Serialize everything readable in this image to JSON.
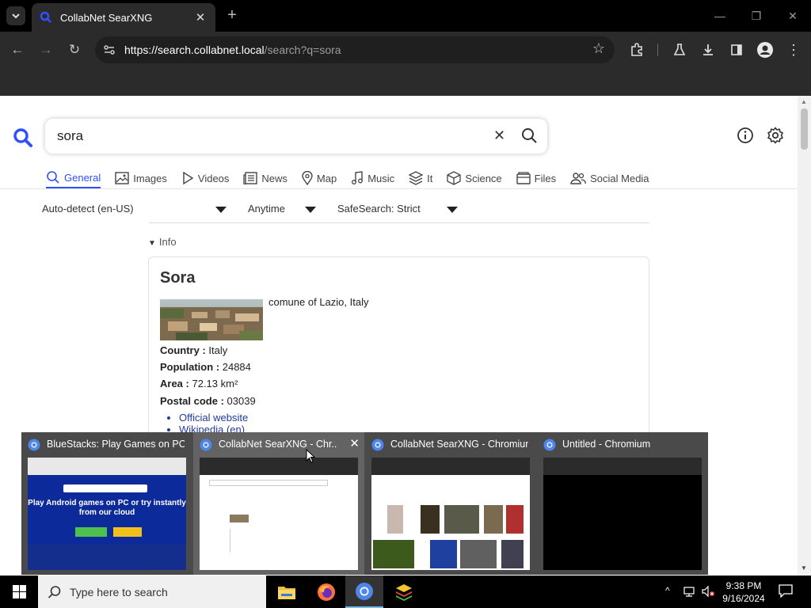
{
  "browser": {
    "tab_title": "CollabNet SearXNG",
    "url_host": "https://search.collabnet.local",
    "url_path": "/search?q=sora"
  },
  "search": {
    "query": "sora"
  },
  "categories": [
    {
      "label": "General",
      "icon": "search-icon"
    },
    {
      "label": "Images",
      "icon": "image-icon"
    },
    {
      "label": "Videos",
      "icon": "play-icon"
    },
    {
      "label": "News",
      "icon": "newspaper-icon"
    },
    {
      "label": "Map",
      "icon": "map-pin-icon"
    },
    {
      "label": "Music",
      "icon": "music-note-icon"
    },
    {
      "label": "It",
      "icon": "layers-icon"
    },
    {
      "label": "Science",
      "icon": "box-icon"
    },
    {
      "label": "Files",
      "icon": "files-icon"
    },
    {
      "label": "Social Media",
      "icon": "people-icon"
    }
  ],
  "filters": {
    "language": "Auto-detect (en-US)",
    "time": "Anytime",
    "safesearch": "SafeSearch: Strict"
  },
  "infobox": {
    "toggle_label": "Info",
    "title": "Sora",
    "description": "comune of Lazio, Italy",
    "attributes": [
      {
        "label": "Country :",
        "value": "Italy"
      },
      {
        "label": "Population :",
        "value": "24884"
      },
      {
        "label": "Area :",
        "value": "72.13 km²"
      },
      {
        "label": "Postal code :",
        "value": "03039"
      }
    ],
    "links": [
      "Official website",
      "Wikipedia (en)"
    ]
  },
  "thumbnails": [
    {
      "title": "BlueStacks: Play Games on PC ...",
      "preview_text": "Play Android games on PC or try instantly from our cloud"
    },
    {
      "title": "CollabNet SearXNG - Chr..."
    },
    {
      "title": "CollabNet SearXNG - Chromium"
    },
    {
      "title": "Untitled - Chromium"
    }
  ],
  "taskbar": {
    "search_placeholder": "Type here to search",
    "time": "9:38 PM",
    "date": "9/16/2024"
  },
  "colors": {
    "accent": "#3050ff",
    "link": "#1f3a9e",
    "chrome_dark": "#2b2b2b"
  }
}
